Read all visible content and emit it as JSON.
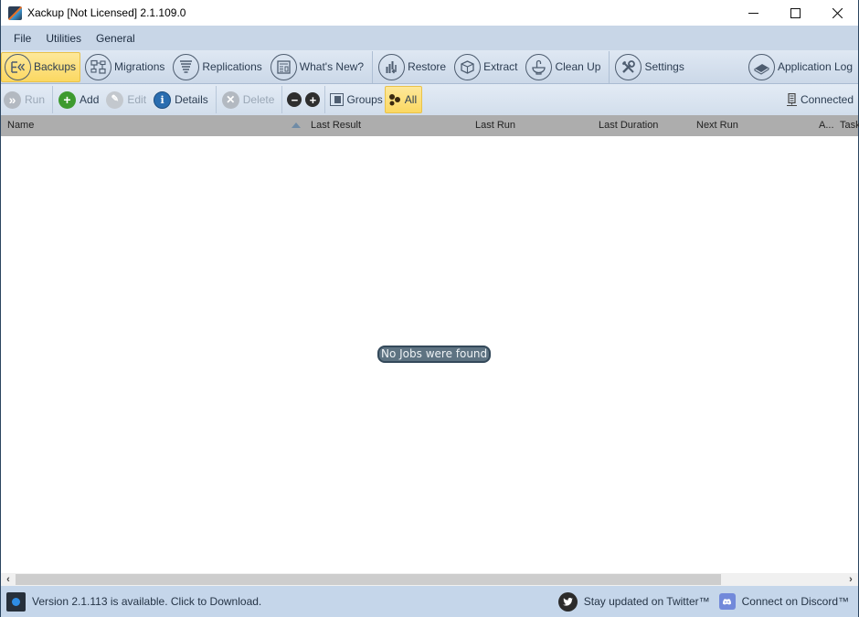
{
  "window": {
    "title": "Xackup [Not Licensed]  2.1.109.0",
    "controls": {
      "minimize": "minimize",
      "maximize": "maximize",
      "close": "close"
    }
  },
  "menu": [
    "File",
    "Utilities",
    "General"
  ],
  "ribbon": {
    "items": [
      {
        "label": "Backups",
        "icon": "backups-icon",
        "active": true
      },
      {
        "label": "Migrations",
        "icon": "migrations-icon"
      },
      {
        "label": "Replications",
        "icon": "replications-icon"
      },
      {
        "label": "What's New?",
        "icon": "news-icon"
      },
      {
        "label": "Restore",
        "icon": "restore-icon"
      },
      {
        "label": "Extract",
        "icon": "extract-icon"
      },
      {
        "label": "Clean Up",
        "icon": "clean-up-icon"
      },
      {
        "label": "Settings",
        "icon": "settings-icon"
      },
      {
        "label": "Application Log",
        "icon": "application-log-icon"
      }
    ]
  },
  "toolbar": {
    "run": "Run",
    "add": "Add",
    "edit": "Edit",
    "details": "Details",
    "delete": "Delete",
    "collapse": "−",
    "expand": "+",
    "groups": "Groups",
    "all": "All",
    "connection_status": "Connected",
    "colors": {
      "add": "#3d9a2f",
      "details": "#2a6db0",
      "disabled": "#b3b9c1",
      "dark": "#2e2e2e",
      "active": "#fbd862"
    }
  },
  "table": {
    "columns": [
      "Name",
      "Last Result",
      "Last Run",
      "Last Duration",
      "Next Run",
      "A...",
      "Task"
    ],
    "rows": [],
    "empty_message": "No Jobs were found"
  },
  "scrollbar": {
    "left": "‹",
    "right": "›"
  },
  "statusbar": {
    "update_text": "Version 2.1.113 is available. Click to Download.",
    "twitter": "Stay updated on Twitter™",
    "discord": "Connect on Discord™"
  }
}
